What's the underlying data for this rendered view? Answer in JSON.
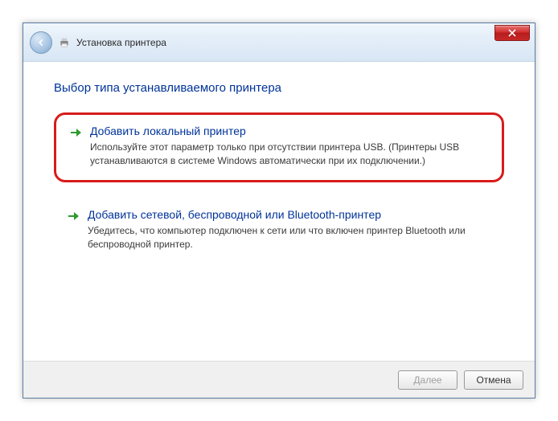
{
  "titlebar": {
    "title": "Установка принтера"
  },
  "content": {
    "heading": "Выбор типа устанавливаемого принтера",
    "options": [
      {
        "title": "Добавить локальный принтер",
        "description": "Используйте этот параметр только при отсутствии принтера USB. (Принтеры USB устанавливаются в системе Windows автоматически при их подключении.)"
      },
      {
        "title": "Добавить сетевой, беспроводной или Bluetooth-принтер",
        "description": "Убедитесь, что компьютер подключен к сети или что включен принтер Bluetooth или беспроводной принтер."
      }
    ]
  },
  "footer": {
    "next": "Далее",
    "cancel": "Отмена"
  },
  "colors": {
    "highlight": "#d81b1b",
    "link": "#003399",
    "arrow": "#2e9a2e"
  }
}
